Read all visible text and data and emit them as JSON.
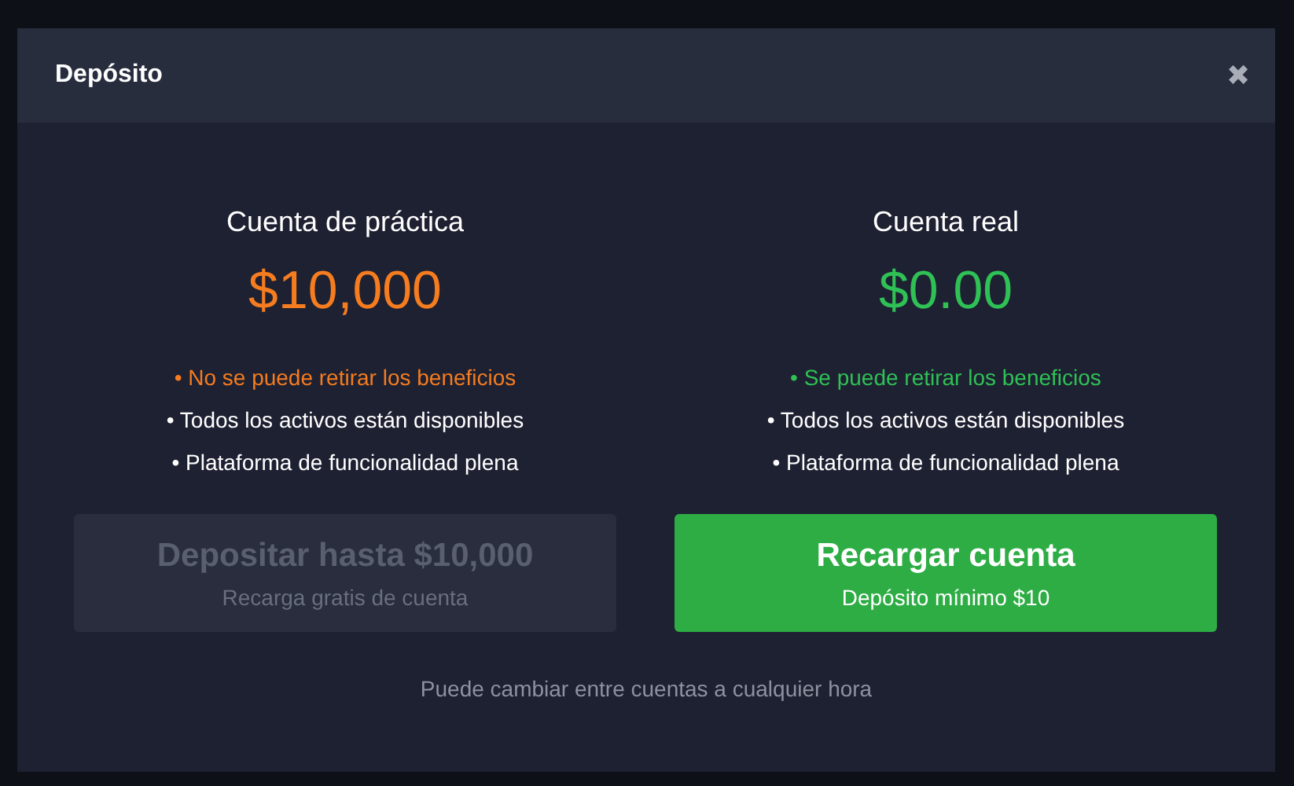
{
  "dialog": {
    "title": "Depósito",
    "close": "✖"
  },
  "accounts": [
    {
      "name": "Cuenta de práctica",
      "balance": "$10,000",
      "color": "#f57c1f",
      "features": [
        {
          "text": "• No se puede retirar los beneficios",
          "highlight": true
        },
        {
          "text": "• Todos los activos están disponibles",
          "highlight": false
        },
        {
          "text": "• Plataforma de funcionalidad plena",
          "highlight": false
        }
      ],
      "button": {
        "label": "Depositar hasta $10,000",
        "sublabel": "Recarga gratis de cuenta",
        "disabled": true
      }
    },
    {
      "name": "Cuenta real",
      "balance": "$0.00",
      "color": "#2fc155",
      "features": [
        {
          "text": "• Se puede retirar los beneficios",
          "highlight": true
        },
        {
          "text": "• Todos los activos están disponibles",
          "highlight": false
        },
        {
          "text": "• Plataforma de funcionalidad plena",
          "highlight": false
        }
      ],
      "button": {
        "label": "Recargar cuenta",
        "sublabel": "Depósito mínimo  $10",
        "disabled": false
      }
    }
  ],
  "footer": "Puede cambiar entre cuentas a cualquier hora"
}
